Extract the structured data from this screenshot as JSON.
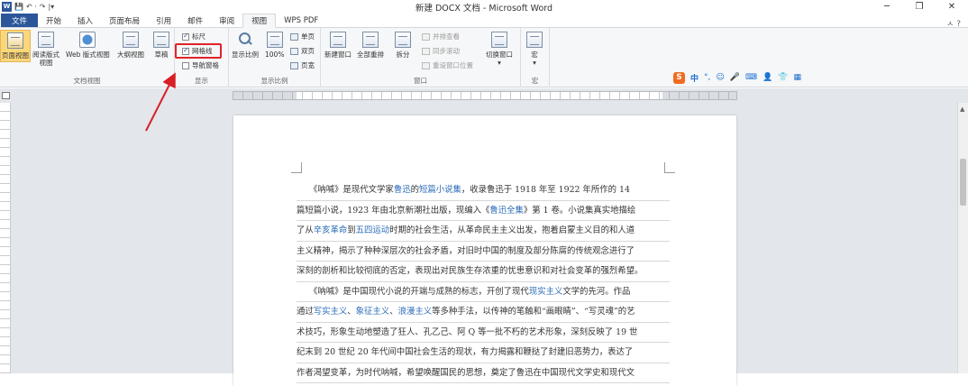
{
  "window": {
    "title": "新建 DOCX 文档 - Microsoft Word",
    "app_logo": "W",
    "qat_items": [
      "💾",
      "↶ ·",
      "↷",
      "|▾"
    ],
    "controls": [
      "─",
      "❐",
      "✕"
    ]
  },
  "tabs": [
    {
      "label": "文件",
      "type": "file"
    },
    {
      "label": "开始"
    },
    {
      "label": "插入"
    },
    {
      "label": "页面布局"
    },
    {
      "label": "引用"
    },
    {
      "label": "邮件"
    },
    {
      "label": "审阅"
    },
    {
      "label": "视图",
      "active": true
    },
    {
      "label": "WPS PDF"
    }
  ],
  "help_icon": "ㅅ ?",
  "ribbon": {
    "document_views": {
      "label": "文档视图",
      "buttons": [
        "页面视图",
        "阅读版式\n视图",
        "Web 版式视图",
        "大纲视图",
        "草稿"
      ]
    },
    "show": {
      "label": "显示",
      "items": [
        {
          "label": "标尺",
          "checked": true
        },
        {
          "label": "网格线",
          "checked": true
        },
        {
          "label": "导航窗格",
          "checked": false
        }
      ]
    },
    "zoom": {
      "label": "显示比例",
      "buttons": [
        "显示比例",
        "100%"
      ],
      "small": [
        "单页",
        "双页",
        "页宽"
      ]
    },
    "window": {
      "label": "窗口",
      "buttons": [
        "新建窗口",
        "全部重排",
        "拆分"
      ],
      "small": [
        "并排查看",
        "同步滚动",
        "重设窗口位置"
      ],
      "switch": "切换窗口"
    },
    "macros": {
      "label": "宏",
      "button": "宏"
    }
  },
  "ime": {
    "logo": "S",
    "mode": "中",
    "icons": [
      "°,",
      "☺",
      "🎤",
      "⌨",
      "👤",
      "👕",
      "▦"
    ]
  },
  "document": {
    "paragraphs": [
      [
        [
          {
            "t": "　　《呐喊》是现代文学家"
          },
          {
            "t": "鲁迅",
            "link": true
          },
          {
            "t": "的"
          },
          {
            "t": "短篇小说集",
            "link": true
          },
          {
            "t": "，收录鲁迅于 1918 年至 1922 年所作的 14"
          }
        ],
        [
          {
            "t": "篇短篇小说，1923 年由北京新潮社出版，现编入《"
          },
          {
            "t": "鲁迅全集",
            "link": true
          },
          {
            "t": "》第 1 卷。小说集真实地描绘"
          }
        ],
        [
          {
            "t": "了从"
          },
          {
            "t": "辛亥革命",
            "link": true
          },
          {
            "t": "到"
          },
          {
            "t": "五四运动",
            "link": true
          },
          {
            "t": "时期的社会生活，从革命民主主义出发，抱着启蒙主义目的和人道"
          }
        ],
        [
          {
            "t": "主义精神，揭示了种种深层次的社会矛盾，对旧时中国的制度及部分陈腐的传统观念进行了"
          }
        ],
        [
          {
            "t": "深刻的剖析和比较彻底的否定，表现出对民族生存浓重的忧患意识和对社会变革的强烈希望。"
          }
        ]
      ],
      [
        [
          {
            "t": "　　《呐喊》是中国现代小说的开端与成熟的标志，开创了现代"
          },
          {
            "t": "现实主义",
            "link": true
          },
          {
            "t": "文学的先河。作品"
          }
        ],
        [
          {
            "t": "通过"
          },
          {
            "t": "写实主义",
            "link": true
          },
          {
            "t": "、"
          },
          {
            "t": "象征主义",
            "link": true
          },
          {
            "t": "、"
          },
          {
            "t": "浪漫主义",
            "link": true
          },
          {
            "t": "等多种手法，以传神的笔触和“画眼睛”、“写灵魂”的艺"
          }
        ],
        [
          {
            "t": "术技巧，形象生动地塑造了狂人、孔乙己、阿 Q 等一批不朽的艺术形象，深刻反映了 19 世"
          }
        ],
        [
          {
            "t": "纪末到 20 世纪 20 年代间中国社会生活的现状，有力揭露和鞭挞了封建旧恶势力，表达了"
          }
        ],
        [
          {
            "t": "作者渴望变革，为时代呐喊，希望唤醒国民的思想，奠定了鲁迅在中国现代文学史和现代文"
          }
        ]
      ]
    ]
  },
  "colors": {
    "accent": "#2b579a",
    "link": "#2a6bb8",
    "highlight_box": "#e0232a",
    "arrow": "#d82027"
  }
}
